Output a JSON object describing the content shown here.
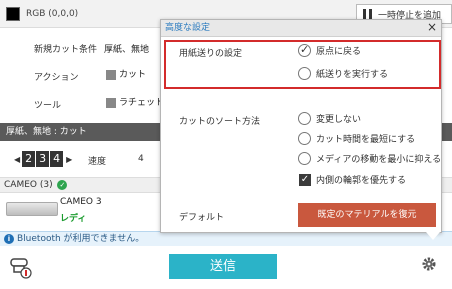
{
  "topbar": {
    "rgb_label": "RGB (0,0,0)",
    "pause_label": "一時停止を追加"
  },
  "settings": {
    "cut_condition_label": "新規カット条件",
    "cut_condition_value": "厚紙、無地",
    "action_label": "アクション",
    "action_value": "カット",
    "tool_label": "ツール",
    "tool_value": "ラチェット"
  },
  "section": {
    "title": "厚紙、無地 : カット"
  },
  "counter": {
    "digits": [
      "2",
      "3",
      "4"
    ],
    "speed_label": "速度",
    "speed_value": "4"
  },
  "device": {
    "list_label": "CAMEO (3)",
    "name": "CAMEO 3",
    "status": "レディ"
  },
  "bluetooth": {
    "message": "Bluetooth が利用できません。"
  },
  "send_button": {
    "label": "送信"
  },
  "popup": {
    "title": "高度な設定",
    "feed": {
      "label": "用紙送りの設定",
      "options": [
        {
          "label": "原点に戻る",
          "selected": true
        },
        {
          "label": "紙送りを実行する",
          "selected": false
        }
      ]
    },
    "sort": {
      "label": "カットのソート方法",
      "options": [
        {
          "label": "変更しない",
          "type": "radio",
          "selected": false
        },
        {
          "label": "カット時間を最短にする",
          "type": "radio",
          "selected": false
        },
        {
          "label": "メディアの移動を最小に抑える",
          "type": "radio",
          "selected": false
        },
        {
          "label": "内側の輪郭を優先する",
          "type": "checkbox",
          "checked": true
        }
      ]
    },
    "default_label": "デフォルト",
    "restore_button": "既定のマテリアルを復元"
  },
  "colors": {
    "accent": "#2bb3c8",
    "highlight": "#d32b2b",
    "restore": "#c9583e",
    "ready": "#1a9b2e"
  },
  "icons": {
    "close": "close-icon",
    "gear": "gear-icon",
    "tool": "cutter-tool-icon",
    "info": "info-icon"
  }
}
